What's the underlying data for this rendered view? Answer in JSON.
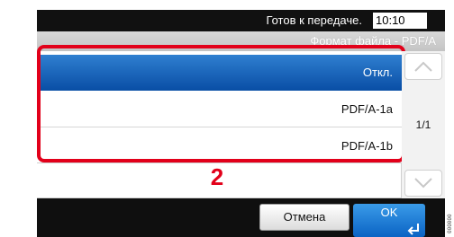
{
  "status": {
    "message": "Готов к передаче.",
    "time": "10:10"
  },
  "title": "Формат файла - PDF/A",
  "options": [
    {
      "label": "Откл.",
      "selected": true
    },
    {
      "label": "PDF/A-1a",
      "selected": false
    },
    {
      "label": "PDF/A-1b",
      "selected": false
    }
  ],
  "callout": "2",
  "pagination": "1/1",
  "buttons": {
    "cancel": "Отмена",
    "ok": "OK"
  },
  "image_code": "000000",
  "colors": {
    "selected": "#0a4fa6",
    "highlight": "#e2001a",
    "ok": "#0a63c4"
  },
  "icons": {
    "scroll_up": "chevron-up-icon",
    "scroll_down": "chevron-down-icon",
    "enter": "enter-arrow-icon"
  }
}
